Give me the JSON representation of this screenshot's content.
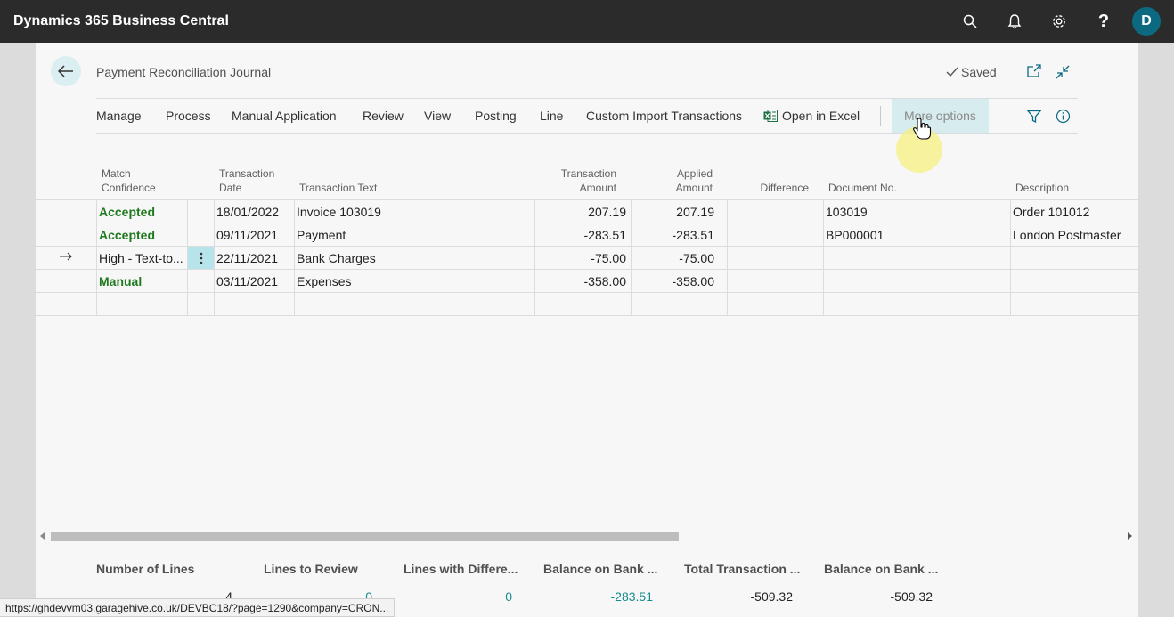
{
  "app": {
    "title": "Dynamics 365 Business Central",
    "user_initial": "D"
  },
  "header_icons": [
    "search-icon",
    "bell-icon",
    "gear-icon",
    "help-icon"
  ],
  "page": {
    "title": "Payment Reconciliation Journal",
    "saved_label": "Saved"
  },
  "actions": [
    "Manage",
    "Process",
    "Manual Application",
    "Review",
    "View",
    "Posting",
    "Line",
    "Custom Import Transactions",
    "Open in Excel",
    "More options"
  ],
  "columns": {
    "match_confidence": [
      "Match",
      "Confidence"
    ],
    "transaction_date": [
      "Transaction",
      "Date"
    ],
    "transaction_text": "Transaction Text",
    "transaction_amount": [
      "Transaction",
      "Amount"
    ],
    "applied_amount": [
      "Applied",
      "Amount"
    ],
    "difference": "Difference",
    "document_no": "Document No.",
    "description": "Description"
  },
  "rows": [
    {
      "match": "Accepted",
      "date": "18/01/2022",
      "text": "Invoice 103019",
      "amount": "207.19",
      "applied": "207.19",
      "difference": "",
      "doc": "103019",
      "description": "Order 101012"
    },
    {
      "match": "Accepted",
      "date": "09/11/2021",
      "text": "Payment",
      "amount": "-283.51",
      "applied": "-283.51",
      "difference": "",
      "doc": "BP000001",
      "description": "London Postmaster"
    },
    {
      "match": "High - Text-to...",
      "date": "22/11/2021",
      "text": "Bank Charges",
      "amount": "-75.00",
      "applied": "-75.00",
      "difference": "",
      "doc": "",
      "description": ""
    },
    {
      "match": "Manual",
      "date": "03/11/2021",
      "text": "Expenses",
      "amount": "-358.00",
      "applied": "-358.00",
      "difference": "",
      "doc": "",
      "description": ""
    }
  ],
  "cues": [
    {
      "label": "Number of Lines",
      "value": "4"
    },
    {
      "label": "Lines to Review",
      "value": "0"
    },
    {
      "label": "Lines with Differe...",
      "value": "0"
    },
    {
      "label": "Balance on Bank ...",
      "value": "-283.51"
    },
    {
      "label": "Total Transaction ...",
      "value": "-509.32"
    },
    {
      "label": "Balance on Bank ...",
      "value": "-509.32"
    }
  ],
  "status_url": "https://ghdevvm03.garagehive.co.uk/DEVBC18/?page=1290&company=CRON...",
  "colors": {
    "topbar": "#2b2b2b",
    "accent": "#0b6a80",
    "accepted": "#1f7a1f",
    "cue_teal": "#158a8f"
  }
}
